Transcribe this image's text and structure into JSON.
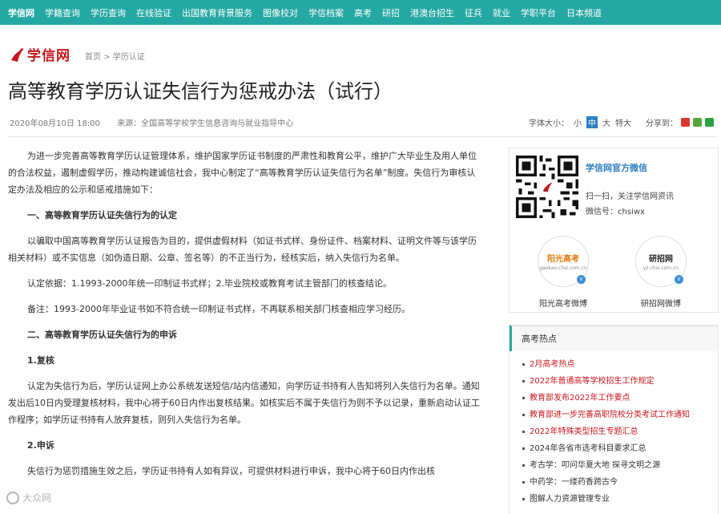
{
  "nav": [
    "学信网",
    "学籍查询",
    "学历查询",
    "在线验证",
    "出国教育背景服务",
    "图像校对",
    "学信档案",
    "高考",
    "研招",
    "港澳台招生",
    "征兵",
    "就业",
    "学职平台",
    "日本频道"
  ],
  "logo": {
    "text": "学信网"
  },
  "breadcrumb": {
    "home": "首页",
    "sep": ">",
    "current": "学历认证"
  },
  "article_title": "高等教育学历认证失信行为惩戒办法（试行）",
  "meta": {
    "date": "2020年08月10日 18:00",
    "source": "来源：全国高等学校学生信息咨询与就业指导中心"
  },
  "font_size": {
    "label": "字体大小：",
    "small": "小",
    "medium": "中",
    "large": "大",
    "xlarge": "特大"
  },
  "share": {
    "label": "分享到："
  },
  "article": {
    "p1": "为进一步完善高等教育学历认证管理体系，维护国家学历证书制度的严肃性和教育公平，维护广大毕业生及用人单位的合法权益，遏制虚假学历，推动构建诚信社会，我中心制定了“高等教育学历认证失信行为名单”制度。失信行为审核认定办法及相应的公示和惩戒措施如下：",
    "h1": "一、高等教育学历认证失信行为的认定",
    "p2": "以骗取中国高等教育学历认证报告为目的，提供虚假材料（如证书式样、身份证件、档案材料、证明文件等与该学历相关材料）或不实信息（如伪造日期、公章、签名等）的不正当行为，经核实后，纳入失信行为名单。",
    "p3": "认定依据：1.1993-2000年统一印制证书式样；2.毕业院校或教育考试主管部门的核查结论。",
    "p4": "备注：1993-2000年毕业证书如不符合统一印制证书式样，不再联系相关部门核查相应学习经历。",
    "h2": "二、高等教育学历认证失信行为的申诉",
    "h3": "1.复核",
    "p5": "认定为失信行为后，学历认证网上办公系统发送短信/站内信通知，向学历证书持有人告知将列入失信行为名单。通知发出后10日内受理复核材料，我中心将于60日内作出复核结果。如核实后不属于失信行为则不予以记录，重新启动认证工作程序；如学历证书持有人放弃复核，则列入失信行为名单。",
    "h4": "2.申诉",
    "p6": "失信行为惩罚措施生效之后，学历证书持有人如有异议，可提供材料进行申诉，我中心将于60日内作出核"
  },
  "sidebar": {
    "wechat_title": "学信网官方微信",
    "wechat_desc": "扫一扫，关注学信网资讯",
    "wechat_id": "微信号：chsiwx",
    "weibo1": {
      "brand": "阳光高考",
      "url": "gaokao.chsi.com.cn",
      "caption": "阳光高考微博"
    },
    "weibo2": {
      "brand": "研招网",
      "url": "yz.chsi.com.cn",
      "caption": "研招网微博"
    },
    "hot_title": "高考热点",
    "hot_items": [
      "2月高考热点",
      "2022年普通高等学校招生工作规定",
      "教育部发布2022年工作要点",
      "教育部进一步完善高职院校分类考试工作通知",
      "2022年特殊类型招生专题汇总",
      "2024年各省市选考科目要求汇总",
      "考古学：叩问华夏大地 探寻文明之源",
      "中药学：一缕药香跨古今",
      "图解人力资源管理专业"
    ],
    "hot_item_colors": [
      "#c8161d",
      "#c8161d",
      "#c8161d",
      "#c8161d",
      "#c8161d",
      "#333333",
      "#333333",
      "#333333",
      "#333333"
    ]
  },
  "colors": {
    "nav_bg": "#25a8a4",
    "logo_red": "#c4161c",
    "link_blue": "#2c7fc0",
    "hot_red": "#c8161d"
  },
  "watermark": "大众网"
}
